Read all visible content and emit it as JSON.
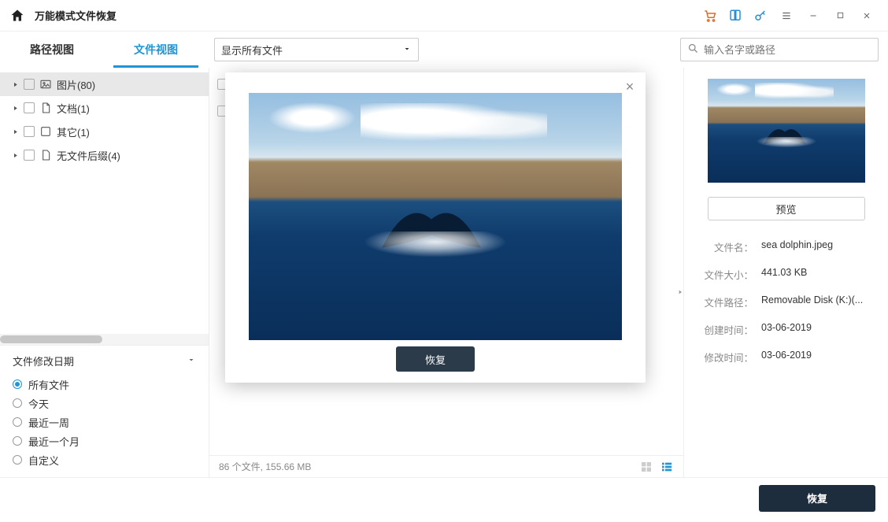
{
  "app": {
    "title": "万能模式文件恢复"
  },
  "tabs": {
    "path": "路径视图",
    "file": "文件视图"
  },
  "filter_select": {
    "label": "显示所有文件"
  },
  "search": {
    "placeholder": "输入名字或路径"
  },
  "tree": [
    {
      "label": "图片(80)",
      "selected": true
    },
    {
      "label": "文档(1)",
      "selected": false
    },
    {
      "label": "其它(1)",
      "selected": false
    },
    {
      "label": "无文件后缀(4)",
      "selected": false
    }
  ],
  "date_filter": {
    "title": "文件修改日期",
    "options": [
      "所有文件",
      "今天",
      "最近一周",
      "最近一个月",
      "自定义"
    ],
    "selected": 0
  },
  "status": {
    "text": "86 个文件, 155.66  MB"
  },
  "preview": {
    "button": "预览",
    "meta_labels": {
      "name": "文件名：",
      "size": "文件大小：",
      "path": "文件路径：",
      "created": "创建时间：",
      "modified": "修改时间："
    },
    "meta": {
      "name": "sea dolphin.jpeg",
      "size": "441.03  KB",
      "path": "Removable Disk (K:)(...",
      "created": "03-06-2019",
      "modified": "03-06-2019"
    }
  },
  "modal": {
    "recover": "恢复"
  },
  "bottom": {
    "recover": "恢复"
  }
}
